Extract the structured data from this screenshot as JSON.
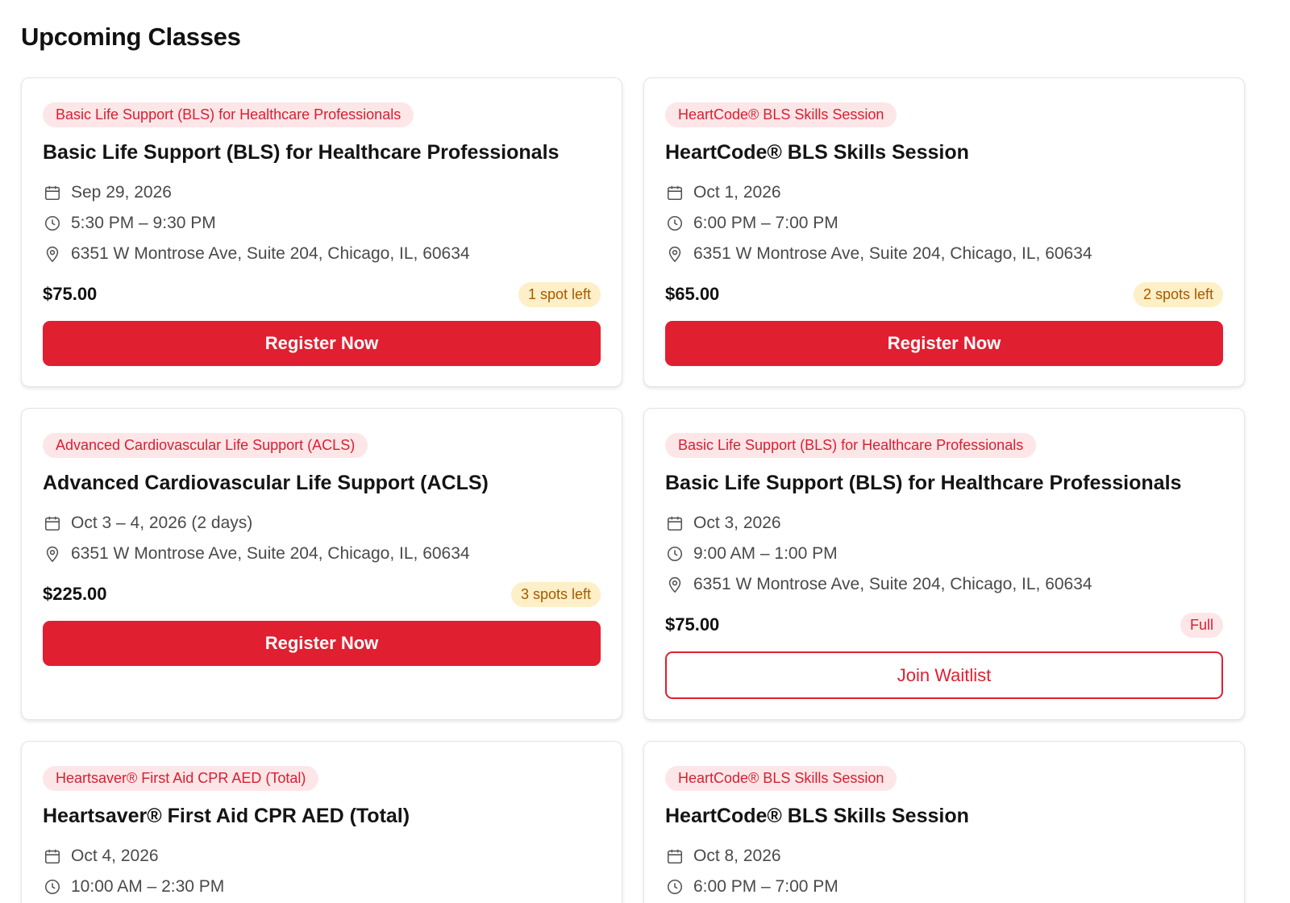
{
  "page": {
    "title": "Upcoming Classes"
  },
  "icons": {
    "date": "calendar-icon",
    "time": "clock-icon",
    "location": "map-pin-icon"
  },
  "colors": {
    "accent": "#e01f31",
    "tag_bg": "#fde6e8",
    "low_badge_bg": "#fdefc7",
    "low_badge_text": "#a65a00"
  },
  "classes": [
    {
      "tag": "Basic Life Support (BLS) for Healthcare Professionals",
      "title": "Basic Life Support (BLS) for Healthcare Professionals",
      "date": "Sep 29, 2026",
      "time": "5:30 PM – 9:30 PM",
      "location": "6351 W Montrose Ave, Suite 204, Chicago, IL, 60634",
      "price": "$75.00",
      "availability": "1 spot left",
      "availability_kind": "low",
      "action": "Register Now",
      "action_kind": "primary"
    },
    {
      "tag": "HeartCode® BLS Skills Session",
      "title": "HeartCode® BLS Skills Session",
      "date": "Oct 1, 2026",
      "time": "6:00 PM – 7:00 PM",
      "location": "6351 W Montrose Ave, Suite 204, Chicago, IL, 60634",
      "price": "$65.00",
      "availability": "2 spots left",
      "availability_kind": "low",
      "action": "Register Now",
      "action_kind": "primary"
    },
    {
      "tag": "Advanced Cardiovascular Life Support (ACLS)",
      "title": "Advanced Cardiovascular Life Support (ACLS)",
      "date": "Oct 3 – 4, 2026 (2 days)",
      "location": "6351 W Montrose Ave, Suite 204, Chicago, IL, 60634",
      "price": "$225.00",
      "availability": "3 spots left",
      "availability_kind": "low",
      "action": "Register Now",
      "action_kind": "primary"
    },
    {
      "tag": "Basic Life Support (BLS) for Healthcare Professionals",
      "title": "Basic Life Support (BLS) for Healthcare Professionals",
      "date": "Oct 3, 2026",
      "time": "9:00 AM – 1:00 PM",
      "location": "6351 W Montrose Ave, Suite 204, Chicago, IL, 60634",
      "price": "$75.00",
      "availability": "Full",
      "availability_kind": "full",
      "action": "Join Waitlist",
      "action_kind": "outline"
    },
    {
      "tag": "Heartsaver® First Aid CPR AED (Total)",
      "title": "Heartsaver® First Aid CPR AED (Total)",
      "date": "Oct 4, 2026",
      "time": "10:00 AM – 2:30 PM"
    },
    {
      "tag": "HeartCode® BLS Skills Session",
      "title": "HeartCode® BLS Skills Session",
      "date": "Oct 8, 2026",
      "time": "6:00 PM – 7:00 PM"
    }
  ]
}
